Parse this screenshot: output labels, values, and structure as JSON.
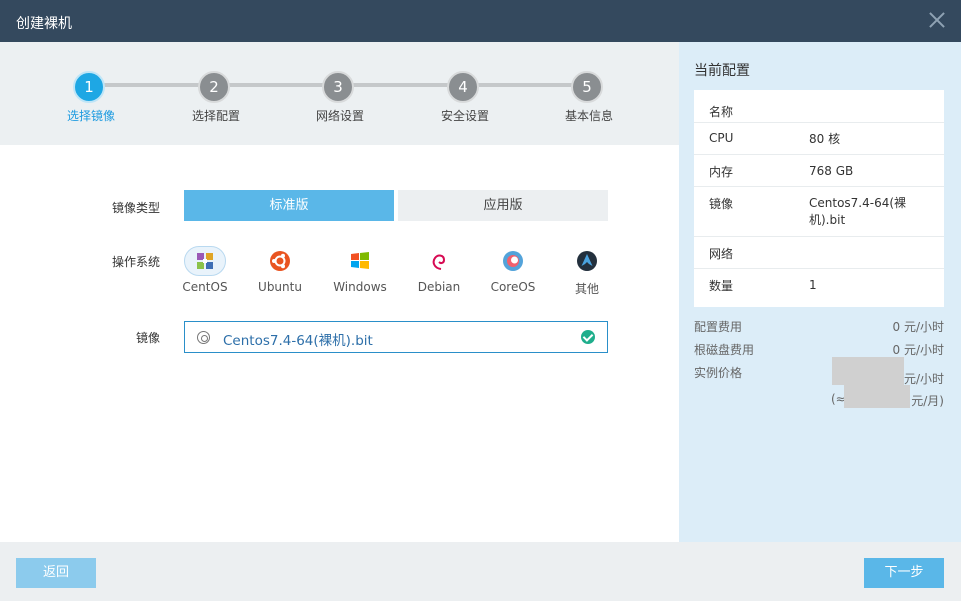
{
  "dialog": {
    "title": "创建裸机"
  },
  "steps": [
    {
      "num": "1",
      "label": "选择镜像"
    },
    {
      "num": "2",
      "label": "选择配置"
    },
    {
      "num": "3",
      "label": "网络设置"
    },
    {
      "num": "4",
      "label": "安全设置"
    },
    {
      "num": "5",
      "label": "基本信息"
    }
  ],
  "form": {
    "image_type_label": "镜像类型",
    "image_type_options": [
      "标准版",
      "应用版"
    ],
    "os_label": "操作系统",
    "os_options": [
      "CentOS",
      "Ubuntu",
      "Windows",
      "Debian",
      "CoreOS",
      "其他"
    ],
    "image_label": "镜像",
    "image_value": "Centos7.4-64(裸机).bit"
  },
  "summary": {
    "title": "当前配置",
    "rows": [
      {
        "k": "名称",
        "v": ""
      },
      {
        "k": "CPU",
        "v": "80 核"
      },
      {
        "k": "内存",
        "v": "768 GB"
      },
      {
        "k": "镜像",
        "v": "Centos7.4-64(裸机).bit"
      },
      {
        "k": "网络",
        "v": ""
      },
      {
        "k": "数量",
        "v": "1"
      }
    ],
    "config_fee_label": "配置费用",
    "config_fee_value": "0 元/小时",
    "disk_fee_label": "根磁盘费用",
    "disk_fee_value": "0 元/小时",
    "instance_price_label": "实例价格",
    "instance_price_hour_suffix": "元/小时",
    "instance_price_month_prefix": "(≈",
    "instance_price_month_suffix": "元/月)"
  },
  "footer": {
    "back_label": "返回",
    "next_label": "下一步"
  },
  "colors": {
    "primary": "#5ab7e8",
    "titlebar": "#34495e",
    "active_step": "#1ea7e4",
    "success": "#1fae8c"
  }
}
